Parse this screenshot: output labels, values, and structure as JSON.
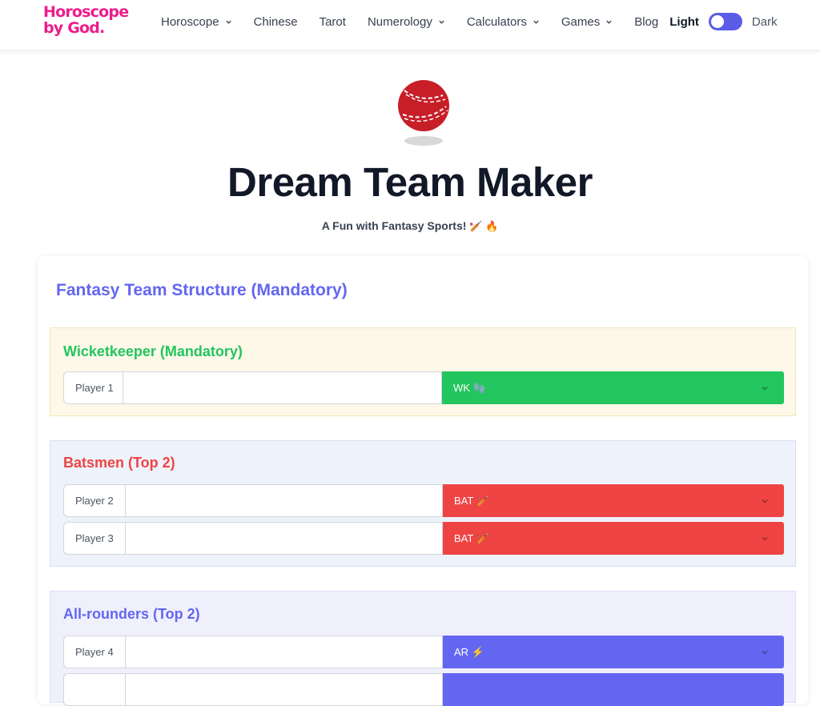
{
  "logo": {
    "line1": "Horoscope",
    "line2": "by God."
  },
  "nav": {
    "items": [
      {
        "label": "Horoscope",
        "dropdown": true
      },
      {
        "label": "Chinese",
        "dropdown": false
      },
      {
        "label": "Tarot",
        "dropdown": false
      },
      {
        "label": "Numerology",
        "dropdown": true
      },
      {
        "label": "Calculators",
        "dropdown": true
      },
      {
        "label": "Games",
        "dropdown": true
      },
      {
        "label": "Blog",
        "dropdown": false
      }
    ],
    "theme": {
      "light_label": "Light",
      "dark_label": "Dark",
      "state": "light"
    }
  },
  "hero": {
    "icon": "cricket-ball-icon",
    "title": "Dream Team Maker",
    "subtitle": "A Fun with Fantasy Sports!",
    "subtitle_emoji": "🏏 🔥"
  },
  "structure": {
    "title": "Fantasy Team Structure (Mandatory)",
    "sections": [
      {
        "title": "Wicketkeeper (Mandatory)",
        "title_color": "#22c55e",
        "bg": "#fdf8e8",
        "border": "#f3e6b8",
        "rows": [
          {
            "player_label": "Player 1",
            "name_value": "",
            "role": "WK 🧤",
            "role_color": "#22c55e"
          }
        ]
      },
      {
        "title": "Batsmen (Top 2)",
        "title_color": "#ef4444",
        "bg": "#eef2fb",
        "border": "#d5dff3",
        "rows": [
          {
            "player_label": "Player 2",
            "name_value": "",
            "role": "BAT 🏏",
            "role_color": "#ef4444"
          },
          {
            "player_label": "Player 3",
            "name_value": "",
            "role": "BAT 🏏",
            "role_color": "#ef4444"
          }
        ]
      },
      {
        "title": "All-rounders (Top 2)",
        "title_color": "#6366f1",
        "bg": "#f0f0fc",
        "border": "#dedff7",
        "rows": [
          {
            "player_label": "Player 4",
            "name_value": "",
            "role": "AR ⚡",
            "role_color": "#6366f1"
          },
          {
            "player_label": "",
            "name_value": "",
            "role": "",
            "role_color": "#6366f1"
          }
        ]
      }
    ]
  }
}
